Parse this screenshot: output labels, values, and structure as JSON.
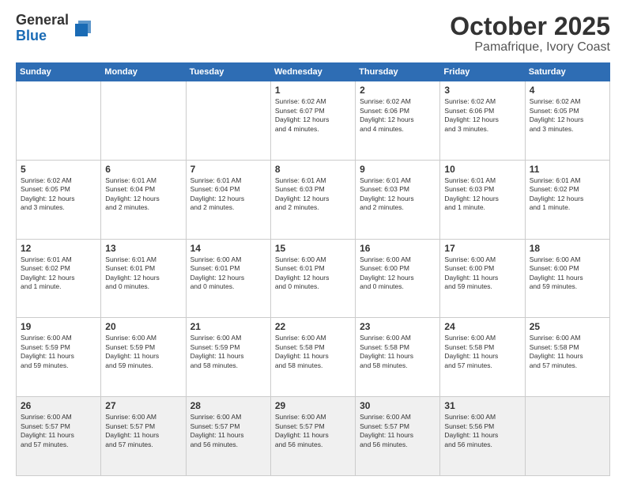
{
  "header": {
    "logo_general": "General",
    "logo_blue": "Blue",
    "month_title": "October 2025",
    "location": "Pamafrique, Ivory Coast"
  },
  "weekdays": [
    "Sunday",
    "Monday",
    "Tuesday",
    "Wednesday",
    "Thursday",
    "Friday",
    "Saturday"
  ],
  "weeks": [
    [
      {
        "day": "",
        "info": ""
      },
      {
        "day": "",
        "info": ""
      },
      {
        "day": "",
        "info": ""
      },
      {
        "day": "1",
        "info": "Sunrise: 6:02 AM\nSunset: 6:07 PM\nDaylight: 12 hours\nand 4 minutes."
      },
      {
        "day": "2",
        "info": "Sunrise: 6:02 AM\nSunset: 6:06 PM\nDaylight: 12 hours\nand 4 minutes."
      },
      {
        "day": "3",
        "info": "Sunrise: 6:02 AM\nSunset: 6:06 PM\nDaylight: 12 hours\nand 3 minutes."
      },
      {
        "day": "4",
        "info": "Sunrise: 6:02 AM\nSunset: 6:05 PM\nDaylight: 12 hours\nand 3 minutes."
      }
    ],
    [
      {
        "day": "5",
        "info": "Sunrise: 6:02 AM\nSunset: 6:05 PM\nDaylight: 12 hours\nand 3 minutes."
      },
      {
        "day": "6",
        "info": "Sunrise: 6:01 AM\nSunset: 6:04 PM\nDaylight: 12 hours\nand 2 minutes."
      },
      {
        "day": "7",
        "info": "Sunrise: 6:01 AM\nSunset: 6:04 PM\nDaylight: 12 hours\nand 2 minutes."
      },
      {
        "day": "8",
        "info": "Sunrise: 6:01 AM\nSunset: 6:03 PM\nDaylight: 12 hours\nand 2 minutes."
      },
      {
        "day": "9",
        "info": "Sunrise: 6:01 AM\nSunset: 6:03 PM\nDaylight: 12 hours\nand 2 minutes."
      },
      {
        "day": "10",
        "info": "Sunrise: 6:01 AM\nSunset: 6:03 PM\nDaylight: 12 hours\nand 1 minute."
      },
      {
        "day": "11",
        "info": "Sunrise: 6:01 AM\nSunset: 6:02 PM\nDaylight: 12 hours\nand 1 minute."
      }
    ],
    [
      {
        "day": "12",
        "info": "Sunrise: 6:01 AM\nSunset: 6:02 PM\nDaylight: 12 hours\nand 1 minute."
      },
      {
        "day": "13",
        "info": "Sunrise: 6:01 AM\nSunset: 6:01 PM\nDaylight: 12 hours\nand 0 minutes."
      },
      {
        "day": "14",
        "info": "Sunrise: 6:00 AM\nSunset: 6:01 PM\nDaylight: 12 hours\nand 0 minutes."
      },
      {
        "day": "15",
        "info": "Sunrise: 6:00 AM\nSunset: 6:01 PM\nDaylight: 12 hours\nand 0 minutes."
      },
      {
        "day": "16",
        "info": "Sunrise: 6:00 AM\nSunset: 6:00 PM\nDaylight: 12 hours\nand 0 minutes."
      },
      {
        "day": "17",
        "info": "Sunrise: 6:00 AM\nSunset: 6:00 PM\nDaylight: 11 hours\nand 59 minutes."
      },
      {
        "day": "18",
        "info": "Sunrise: 6:00 AM\nSunset: 6:00 PM\nDaylight: 11 hours\nand 59 minutes."
      }
    ],
    [
      {
        "day": "19",
        "info": "Sunrise: 6:00 AM\nSunset: 5:59 PM\nDaylight: 11 hours\nand 59 minutes."
      },
      {
        "day": "20",
        "info": "Sunrise: 6:00 AM\nSunset: 5:59 PM\nDaylight: 11 hours\nand 59 minutes."
      },
      {
        "day": "21",
        "info": "Sunrise: 6:00 AM\nSunset: 5:59 PM\nDaylight: 11 hours\nand 58 minutes."
      },
      {
        "day": "22",
        "info": "Sunrise: 6:00 AM\nSunset: 5:58 PM\nDaylight: 11 hours\nand 58 minutes."
      },
      {
        "day": "23",
        "info": "Sunrise: 6:00 AM\nSunset: 5:58 PM\nDaylight: 11 hours\nand 58 minutes."
      },
      {
        "day": "24",
        "info": "Sunrise: 6:00 AM\nSunset: 5:58 PM\nDaylight: 11 hours\nand 57 minutes."
      },
      {
        "day": "25",
        "info": "Sunrise: 6:00 AM\nSunset: 5:58 PM\nDaylight: 11 hours\nand 57 minutes."
      }
    ],
    [
      {
        "day": "26",
        "info": "Sunrise: 6:00 AM\nSunset: 5:57 PM\nDaylight: 11 hours\nand 57 minutes."
      },
      {
        "day": "27",
        "info": "Sunrise: 6:00 AM\nSunset: 5:57 PM\nDaylight: 11 hours\nand 57 minutes."
      },
      {
        "day": "28",
        "info": "Sunrise: 6:00 AM\nSunset: 5:57 PM\nDaylight: 11 hours\nand 56 minutes."
      },
      {
        "day": "29",
        "info": "Sunrise: 6:00 AM\nSunset: 5:57 PM\nDaylight: 11 hours\nand 56 minutes."
      },
      {
        "day": "30",
        "info": "Sunrise: 6:00 AM\nSunset: 5:57 PM\nDaylight: 11 hours\nand 56 minutes."
      },
      {
        "day": "31",
        "info": "Sunrise: 6:00 AM\nSunset: 5:56 PM\nDaylight: 11 hours\nand 56 minutes."
      },
      {
        "day": "",
        "info": ""
      }
    ]
  ]
}
